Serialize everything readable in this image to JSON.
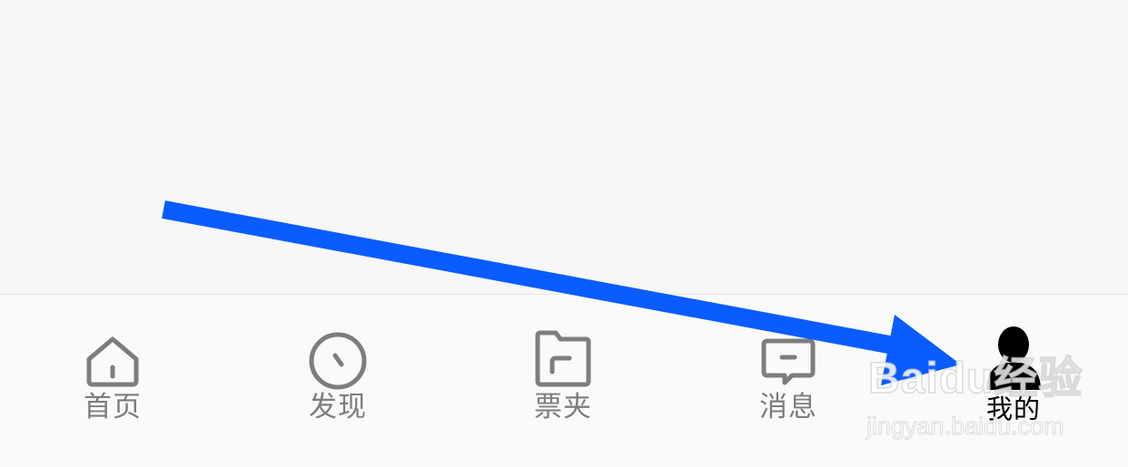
{
  "tab_bar": {
    "tabs": [
      {
        "label": "首页",
        "icon": "home-icon",
        "active": false
      },
      {
        "label": "发现",
        "icon": "compass-icon",
        "active": false
      },
      {
        "label": "票夹",
        "icon": "folder-icon",
        "active": false
      },
      {
        "label": "消息",
        "icon": "message-icon",
        "active": false
      },
      {
        "label": "我的",
        "icon": "person-icon",
        "active": true
      }
    ]
  },
  "annotation": {
    "arrow_color": "#0a5cff"
  },
  "watermark": {
    "logo_text": "Baidu经验",
    "url": "jingyan.baidu.com"
  },
  "colors": {
    "inactive": "#7d7d7d",
    "active": "#000000",
    "background": "#f7f7f7"
  }
}
